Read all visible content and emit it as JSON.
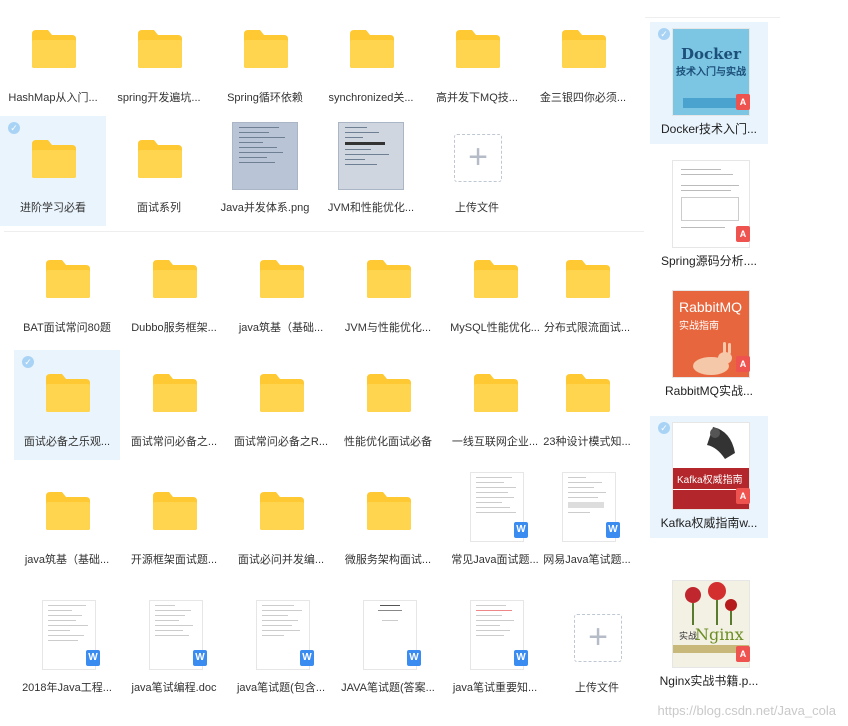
{
  "section1": {
    "row1": [
      {
        "label": "HashMap从入门..."
      },
      {
        "label": "spring开发遍坑..."
      },
      {
        "label": "Spring循环依赖"
      },
      {
        "label": "synchronized关..."
      },
      {
        "label": "高并发下MQ技..."
      },
      {
        "label": "金三银四你必须..."
      }
    ],
    "row2": [
      {
        "label": "进阶学习必看"
      },
      {
        "label": "面试系列"
      },
      {
        "label": "Java并发体系.png"
      },
      {
        "label": "JVM和性能优化..."
      },
      {
        "label": "上传文件"
      }
    ]
  },
  "section2": {
    "row1": [
      {
        "label": "BAT面试常问80题"
      },
      {
        "label": "Dubbo服务框架..."
      },
      {
        "label": "java筑基（基础..."
      },
      {
        "label": "JVM与性能优化..."
      },
      {
        "label": "MySQL性能优化..."
      },
      {
        "label": "分布式限流面试..."
      }
    ],
    "row2": [
      {
        "label": "面试必备之乐观..."
      },
      {
        "label": "面试常问必备之..."
      },
      {
        "label": "面试常问必备之R..."
      },
      {
        "label": "性能优化面试必备"
      },
      {
        "label": "一线互联网企业..."
      },
      {
        "label": "23种设计模式知..."
      }
    ],
    "row3": [
      {
        "label": "java筑基（基础..."
      },
      {
        "label": "开源框架面试题..."
      },
      {
        "label": "面试必问并发编..."
      },
      {
        "label": "微服务架构面试..."
      },
      {
        "label": "常见Java面试题..."
      },
      {
        "label": "网易Java笔试题..."
      }
    ],
    "row4": [
      {
        "label": "2018年Java工程..."
      },
      {
        "label": "java笔试编程.doc"
      },
      {
        "label": "java笔试题(包含..."
      },
      {
        "label": "JAVA笔试题(答案..."
      },
      {
        "label": "java笔试重要知..."
      },
      {
        "label": "上传文件"
      }
    ]
  },
  "books": [
    {
      "label": "Docker技术入门...",
      "cover_title": "Docker",
      "cover_subtitle": "技术入门与实战"
    },
    {
      "label": "Spring源码分析...."
    },
    {
      "label": "RabbitMQ实战...",
      "cover_title": "RabbitMQ",
      "cover_subtitle": "实战指南"
    },
    {
      "label": "Kafka权威指南w...",
      "cover_title": "Kafka权威指南"
    },
    {
      "label": "Nginx实战书籍.p...",
      "cover_title": "Nginx",
      "cover_subtitle": "实战"
    }
  ],
  "badges": {
    "doc": "W",
    "pdf": "A",
    "check": "✓",
    "upload": "+"
  },
  "watermark": "https://blog.csdn.net/Java_cola",
  "colors": {
    "folder": "#FFD24C",
    "folder_tab": "#FFC107",
    "selected_bg": "#EAF4FD",
    "doc_badge": "#3B8CF0",
    "pdf_badge": "#EF5350"
  }
}
